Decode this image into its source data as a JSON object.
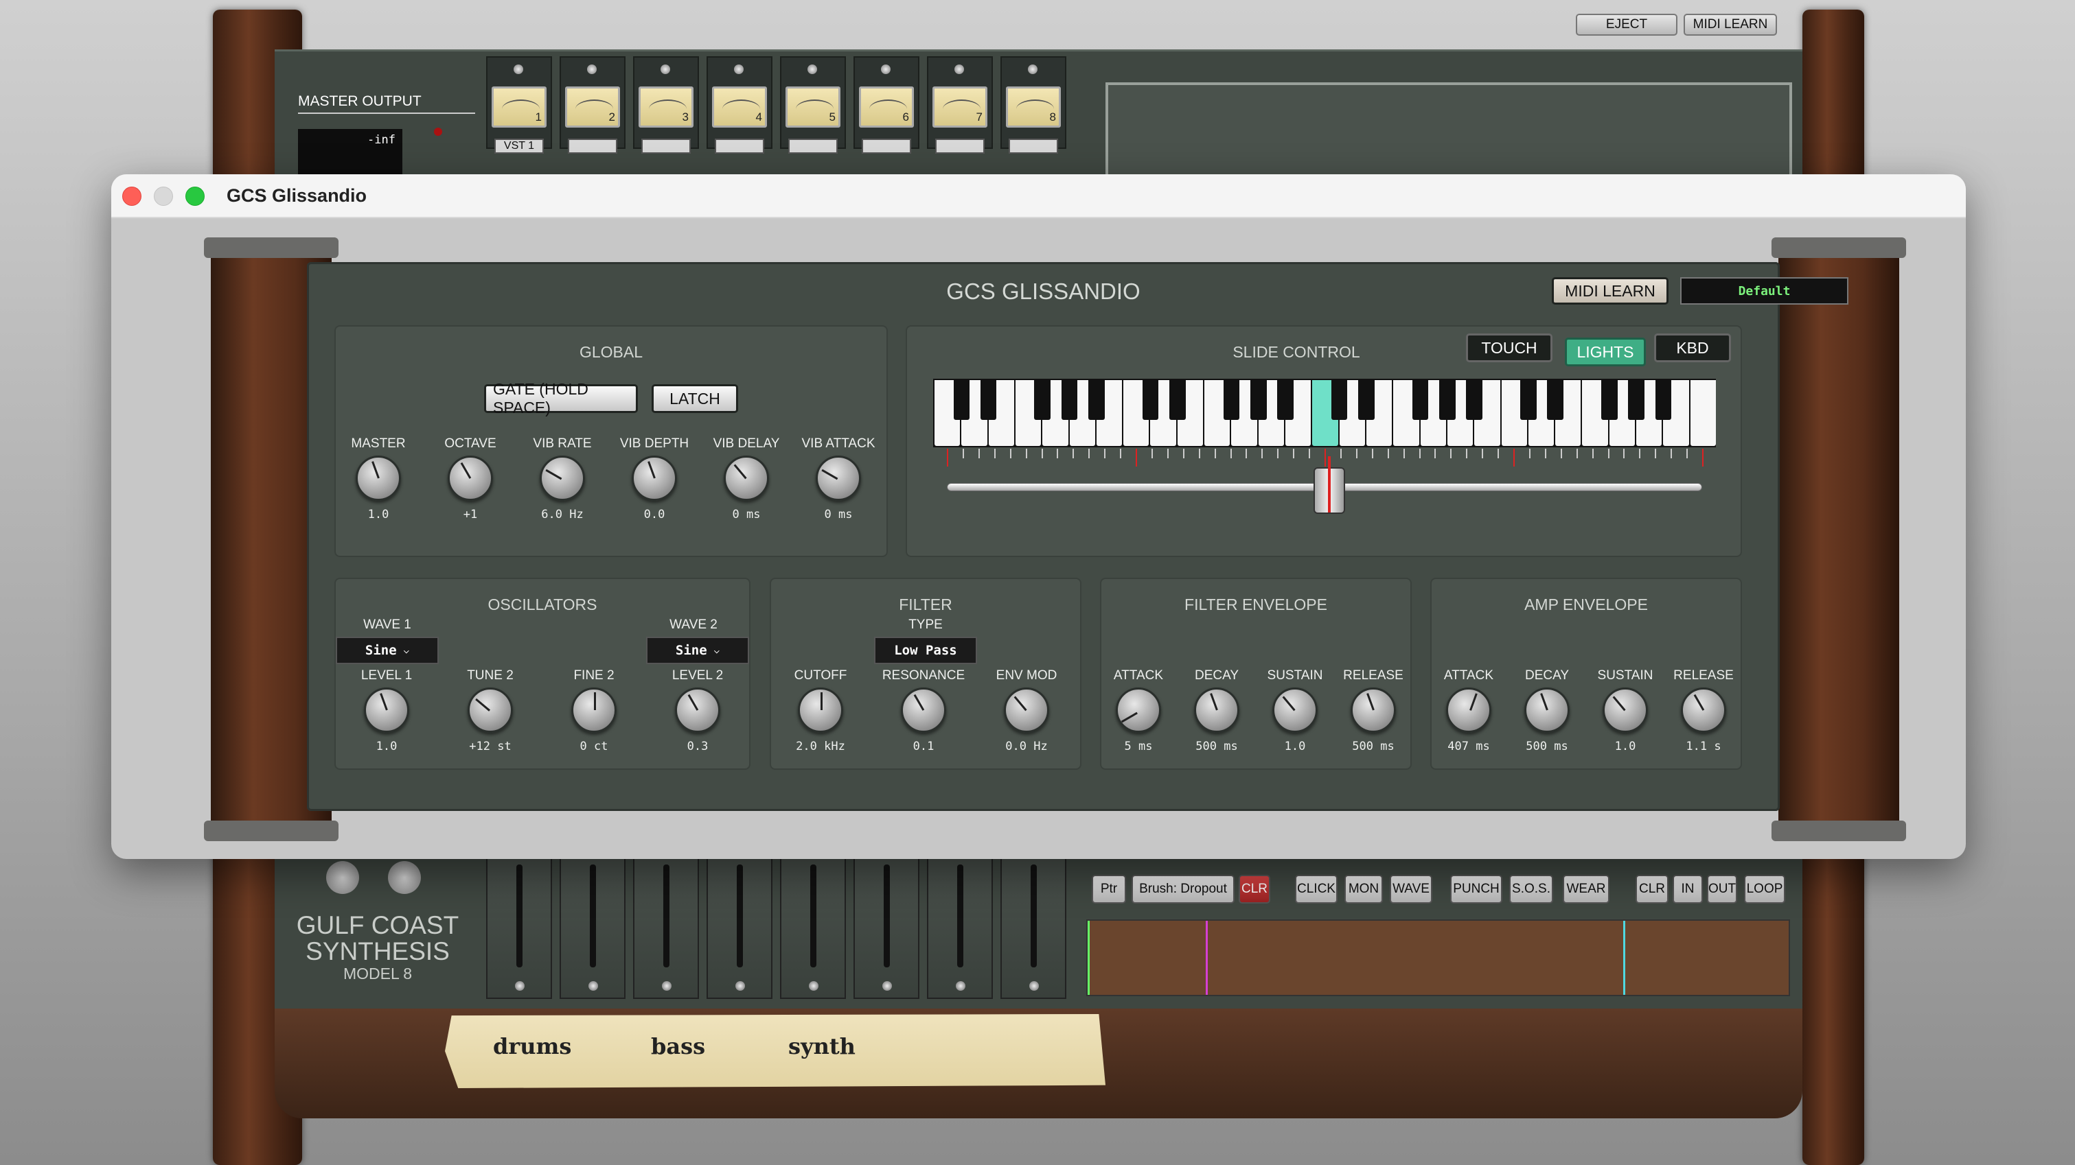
{
  "host": {
    "top_buttons": [
      "EJECT",
      "MIDI LEARN"
    ],
    "master_output_label": "MASTER OUTPUT",
    "master_output_value": "-inf",
    "channel_numbers": [
      "1",
      "2",
      "3",
      "4",
      "5",
      "6",
      "7",
      "8"
    ],
    "channel_1_plugin": "VST 1",
    "brand_line1": "GULF COAST",
    "brand_line2": "SYNTHESIS",
    "brand_model": "MODEL 8",
    "tape_buttons": [
      "Ptr",
      "Brush: Dropout",
      "CLR",
      "CLICK",
      "MON",
      "WAVE",
      "PUNCH",
      "S.O.S.",
      "WEAR",
      "CLR",
      "IN",
      "OUT",
      "LOOP"
    ],
    "tape_labels": [
      "drums",
      "bass",
      "synth"
    ]
  },
  "window": {
    "title": "GCS Glissandio"
  },
  "plugin": {
    "title": "GCS GLISSANDIO",
    "midi_learn": "MIDI LEARN",
    "preset": "Default",
    "global": {
      "title": "GLOBAL",
      "gate": "GATE (HOLD SPACE)",
      "latch": "LATCH",
      "knobs": [
        {
          "label": "MASTER",
          "value": "1.0"
        },
        {
          "label": "OCTAVE",
          "value": "+1"
        },
        {
          "label": "VIB RATE",
          "value": "6.0 Hz"
        },
        {
          "label": "VIB DEPTH",
          "value": "0.0"
        },
        {
          "label": "VIB DELAY",
          "value": "0 ms"
        },
        {
          "label": "VIB ATTACK",
          "value": "0 ms"
        }
      ]
    },
    "slide": {
      "title": "SLIDE CONTROL",
      "buttons": [
        "TOUCH",
        "LIGHTS",
        "KBD"
      ],
      "active_button": "LIGHTS"
    },
    "oscillators": {
      "title": "OSCILLATORS",
      "wave1_label": "WAVE 1",
      "wave1": "Sine",
      "wave2_label": "WAVE 2",
      "wave2": "Sine",
      "knobs": [
        {
          "label": "LEVEL 1",
          "value": "1.0"
        },
        {
          "label": "TUNE 2",
          "value": "+12 st"
        },
        {
          "label": "FINE 2",
          "value": "0 ct"
        },
        {
          "label": "LEVEL 2",
          "value": "0.3"
        }
      ]
    },
    "filter": {
      "title": "FILTER",
      "type_label": "TYPE",
      "type": "Low Pass",
      "knobs": [
        {
          "label": "CUTOFF",
          "value": "2.0 kHz"
        },
        {
          "label": "RESONANCE",
          "value": "0.1"
        },
        {
          "label": "ENV MOD",
          "value": "0.0 Hz"
        }
      ]
    },
    "filter_env": {
      "title": "FILTER ENVELOPE",
      "knobs": [
        {
          "label": "ATTACK",
          "value": "5 ms"
        },
        {
          "label": "DECAY",
          "value": "500 ms"
        },
        {
          "label": "SUSTAIN",
          "value": "1.0"
        },
        {
          "label": "RELEASE",
          "value": "500 ms"
        }
      ]
    },
    "amp_env": {
      "title": "AMP ENVELOPE",
      "knobs": [
        {
          "label": "ATTACK",
          "value": "407 ms"
        },
        {
          "label": "DECAY",
          "value": "500 ms"
        },
        {
          "label": "SUSTAIN",
          "value": "1.0"
        },
        {
          "label": "RELEASE",
          "value": "1.1 s"
        }
      ]
    },
    "colors": {
      "accent": "#3fae85",
      "key_highlight": "#6fe0c8",
      "panel": "#434b45"
    }
  }
}
